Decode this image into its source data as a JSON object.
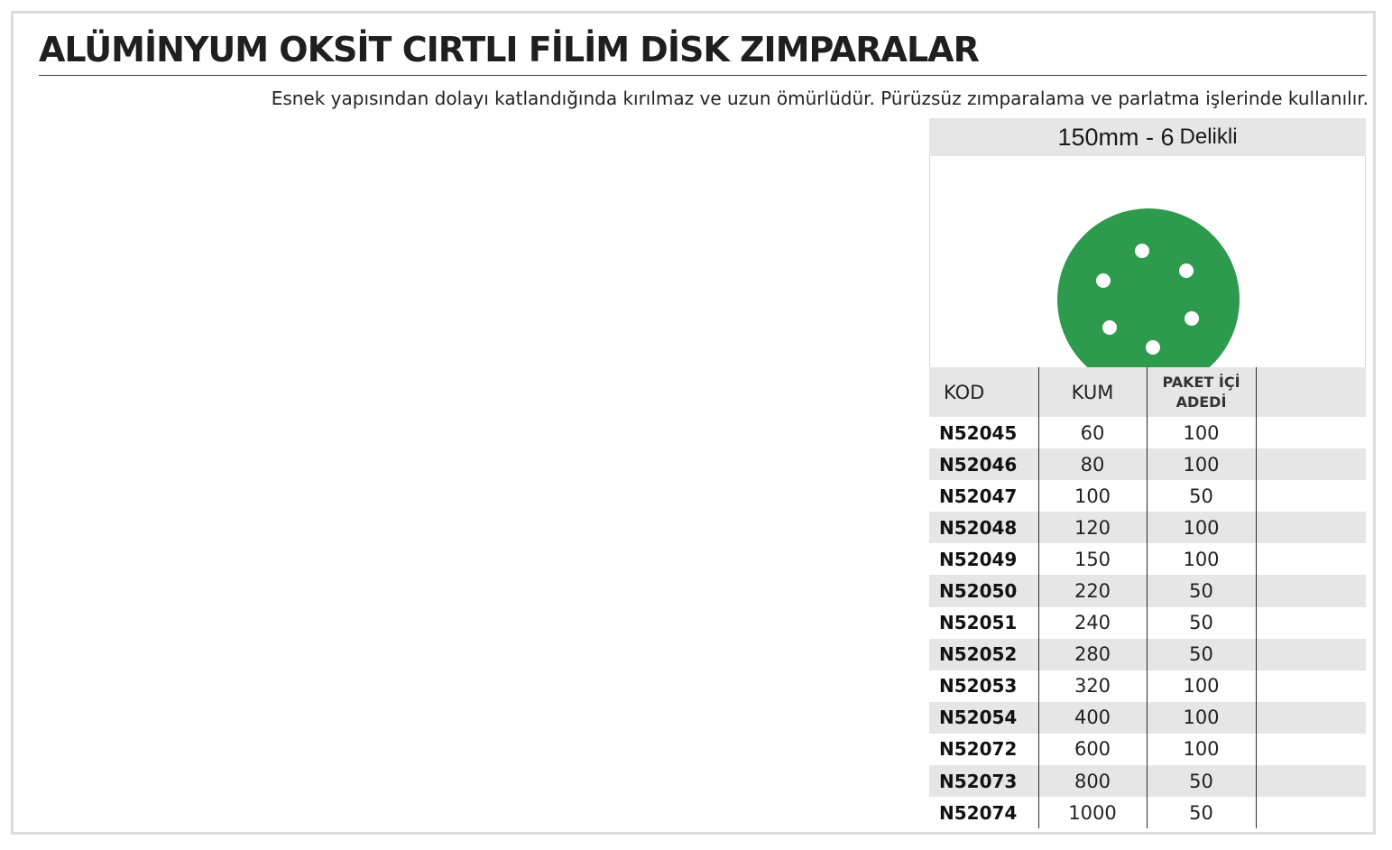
{
  "title": "ALÜMİNYUM OKSİT CIRTLI FİLİM DİSK ZIMPARALAR",
  "subtitle": "Esnek yapısından dolayı katlandığında kırılmaz ve uzun ömürlüdür. Pürüzsüz zımparalama ve parlatma işlerinde kullanılır.",
  "panel": {
    "heading_size": "150mm - 6",
    "heading_unit": "Delikli",
    "disc_color": "#2e9a4e",
    "disc_holes": 6
  },
  "table": {
    "headers": {
      "kod": "KOD",
      "kum": "KUM",
      "paket_line1": "PAKET İÇİ",
      "paket_line2": "ADEDİ"
    },
    "rows": [
      {
        "kod": "N52045",
        "kum": "60",
        "paket": "100"
      },
      {
        "kod": "N52046",
        "kum": "80",
        "paket": "100"
      },
      {
        "kod": "N52047",
        "kum": "100",
        "paket": "50"
      },
      {
        "kod": "N52048",
        "kum": "120",
        "paket": "100"
      },
      {
        "kod": "N52049",
        "kum": "150",
        "paket": "100"
      },
      {
        "kod": "N52050",
        "kum": "220",
        "paket": "50"
      },
      {
        "kod": "N52051",
        "kum": "240",
        "paket": "50"
      },
      {
        "kod": "N52052",
        "kum": "280",
        "paket": "50"
      },
      {
        "kod": "N52053",
        "kum": "320",
        "paket": "100"
      },
      {
        "kod": "N52054",
        "kum": "400",
        "paket": "100"
      },
      {
        "kod": "N52072",
        "kum": "600",
        "paket": "100"
      },
      {
        "kod": "N52073",
        "kum": "800",
        "paket": "50"
      },
      {
        "kod": "N52074",
        "kum": "1000",
        "paket": "50"
      }
    ]
  }
}
